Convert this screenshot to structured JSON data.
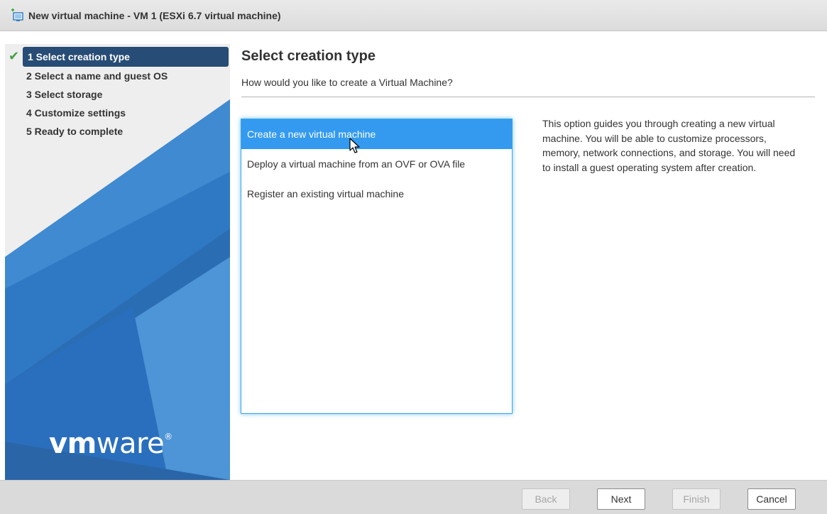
{
  "window": {
    "title": "New virtual machine - VM 1 (ESXi 6.7 virtual machine)",
    "icon": "new-vm-icon"
  },
  "sidebar": {
    "steps": [
      {
        "label": "1 Select creation type",
        "state": "active",
        "completed": true
      },
      {
        "label": "2 Select a name and guest OS",
        "state": "pending"
      },
      {
        "label": "3 Select storage",
        "state": "pending"
      },
      {
        "label": "4 Customize settings",
        "state": "pending"
      },
      {
        "label": "5 Ready to complete",
        "state": "pending"
      }
    ],
    "logo": {
      "bold": "vm",
      "light": "ware",
      "mark": "®"
    }
  },
  "main": {
    "title": "Select creation type",
    "subtitle": "How would you like to create a Virtual Machine?",
    "options": [
      {
        "label": "Create a new virtual machine",
        "selected": true
      },
      {
        "label": "Deploy a virtual machine from an OVF or OVA file",
        "selected": false
      },
      {
        "label": "Register an existing virtual machine",
        "selected": false
      }
    ],
    "description": "This option guides you through creating a new virtual machine. You will be able to customize processors, memory, network connections, and storage. You will need to install a guest operating system after creation."
  },
  "footer": {
    "back": "Back",
    "next": "Next",
    "finish": "Finish",
    "cancel": "Cancel"
  },
  "colors": {
    "accent": "#339af0",
    "active_step": "#274c75",
    "sidebar_blue": "#2d75c0",
    "check_green": "#46a043"
  }
}
